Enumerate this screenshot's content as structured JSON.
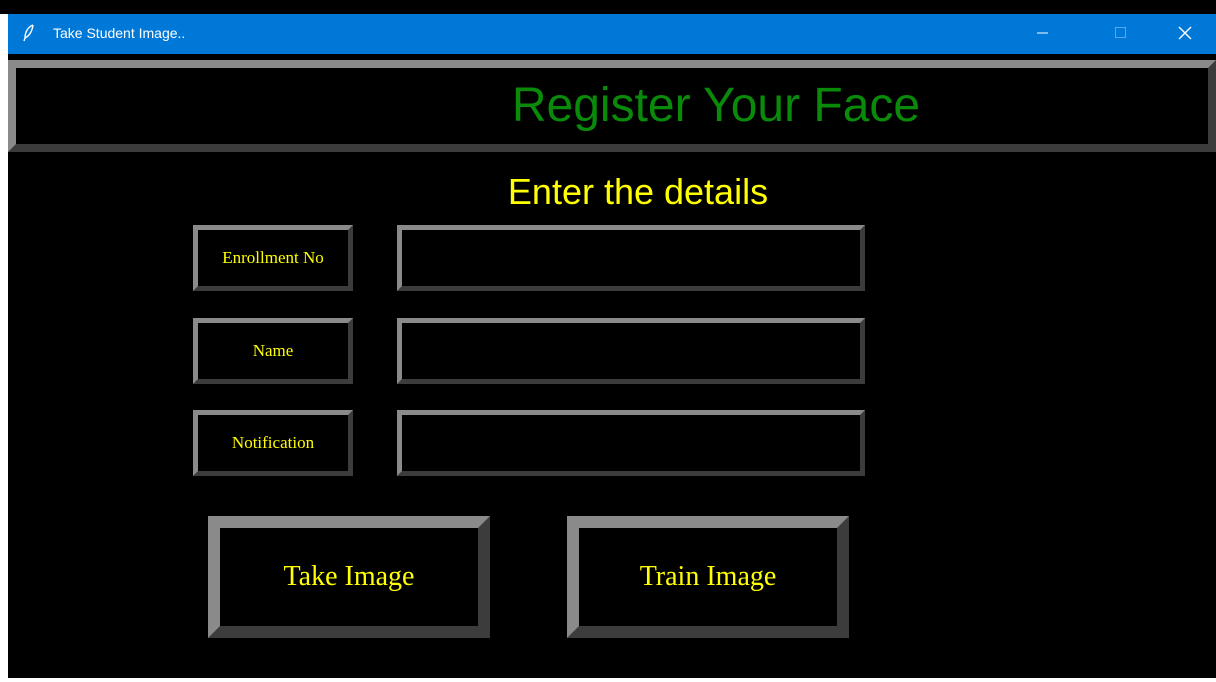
{
  "window": {
    "title": "Take Student Image..",
    "icon": "feather-icon",
    "controls": [
      "minimize-icon",
      "maximize-icon",
      "close-icon"
    ]
  },
  "header": {
    "title": "Register Your Face"
  },
  "form": {
    "heading": "Enter the details",
    "fields": [
      {
        "label": "Enrollment No",
        "value": ""
      },
      {
        "label": "Name",
        "value": ""
      },
      {
        "label": "Notification",
        "value": ""
      }
    ]
  },
  "actions": {
    "take_image": "Take Image",
    "train_image": "Train Image"
  },
  "colors": {
    "title_bar": "#0078d7",
    "background": "#000000",
    "header_text": "#0a8a0a",
    "label_text": "#ffff00"
  }
}
